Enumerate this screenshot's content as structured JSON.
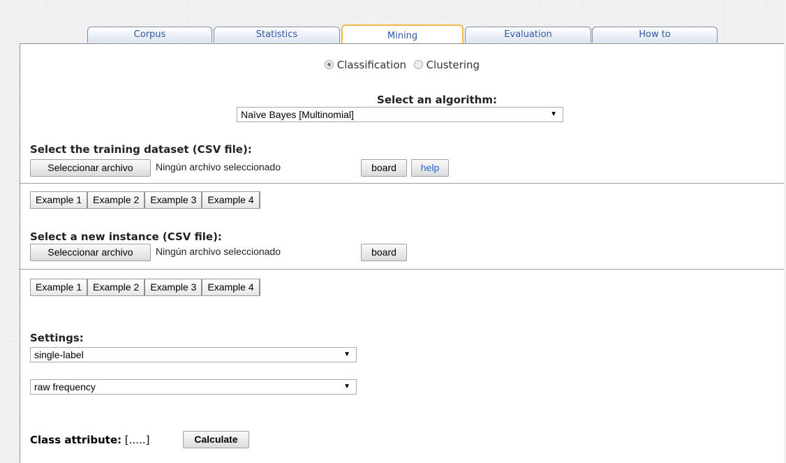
{
  "tabs": [
    {
      "label": "Corpus",
      "active": false
    },
    {
      "label": "Statistics",
      "active": false
    },
    {
      "label": "Mining",
      "active": true
    },
    {
      "label": "Evaluation",
      "active": false
    },
    {
      "label": "How to",
      "active": false
    }
  ],
  "mode": {
    "options": [
      "Classification",
      "Clustering"
    ],
    "selected": "Classification"
  },
  "algorithm": {
    "heading": "Select an algorithm:",
    "selected": "Naïve Bayes [Multinomial]"
  },
  "training": {
    "heading": "Select the training dataset (CSV file):",
    "file_button": "Seleccionar archivo",
    "file_status": "Ningún archivo seleccionado",
    "board_button": "board",
    "help_button": "help",
    "examples": [
      "Example 1",
      "Example 2",
      "Example 3",
      "Example 4"
    ]
  },
  "instance": {
    "heading": "Select a new instance (CSV file):",
    "file_button": "Seleccionar archivo",
    "file_status": "Ningún archivo seleccionado",
    "board_button": "board",
    "examples": [
      "Example 1",
      "Example 2",
      "Example 3",
      "Example 4"
    ]
  },
  "settings": {
    "heading": "Settings:",
    "label_mode": "single-label",
    "weighting": "raw frequency"
  },
  "class_attribute": {
    "label": "Class attribute:",
    "value": "[.....]",
    "calculate_button": "Calculate"
  },
  "colors": {
    "tab_text": "#2e55a3",
    "active_tab_border": "#f2b84a",
    "help_text": "#2a63d8"
  }
}
